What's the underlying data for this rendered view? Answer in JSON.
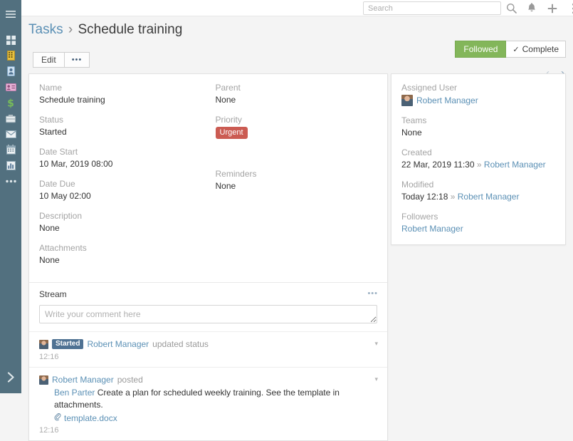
{
  "colors": {
    "sidebar_bg": "#52707f",
    "accent_link": "#5b90b5",
    "followed_green": "#83b65a",
    "urgent_red": "#cb5b52",
    "status_badge_blue": "#4f7293",
    "page_bg": "#f4f4f4"
  },
  "sidebar": {
    "items": [
      {
        "icon": "hamburger-menu-icon",
        "label": "Menu"
      },
      {
        "icon": "dashboard-grid-icon",
        "label": "Dashboard"
      },
      {
        "icon": "building-icon",
        "label": "Accounts"
      },
      {
        "icon": "id-card-icon",
        "label": "Contacts"
      },
      {
        "icon": "lead-card-icon",
        "label": "Leads"
      },
      {
        "icon": "dollar-icon",
        "label": "Opportunities"
      },
      {
        "icon": "briefcase-icon",
        "label": "Cases"
      },
      {
        "icon": "envelope-icon",
        "label": "Email"
      },
      {
        "icon": "calendar-icon",
        "label": "Calendar"
      },
      {
        "icon": "bar-chart-icon",
        "label": "Reports"
      },
      {
        "icon": "ellipsis-icon",
        "label": "More"
      }
    ],
    "expand": {
      "icon": "chevron-right-icon",
      "label": "Expand menu"
    }
  },
  "topbar": {
    "search": {
      "placeholder": "Search",
      "value": ""
    },
    "actions": [
      {
        "icon": "search-icon",
        "label": "Search"
      },
      {
        "icon": "bell-icon",
        "label": "Notifications"
      },
      {
        "icon": "plus-icon",
        "label": "Create"
      },
      {
        "icon": "vertical-dots-icon",
        "label": "Menu"
      }
    ]
  },
  "header": {
    "breadcrumb_parent": "Tasks",
    "breadcrumb_separator": "›",
    "breadcrumb_current": "Schedule training",
    "edit_label": "Edit",
    "more_label": "•••",
    "followed_label": "Followed",
    "complete_label": "Complete",
    "complete_check": "✓",
    "prev_label": "‹",
    "next_label": "›"
  },
  "detail": {
    "left_fields": [
      {
        "label": "Name",
        "value": "Schedule training"
      },
      {
        "label": "Status",
        "value": "Started"
      },
      {
        "label": "Date Start",
        "value": "10 Mar, 2019 08:00"
      },
      {
        "label": "Date Due",
        "value": "10 May 02:00"
      },
      {
        "label": "Description",
        "value": "None"
      },
      {
        "label": "Attachments",
        "value": "None"
      }
    ],
    "right_fields": [
      {
        "label": "Parent",
        "value": "None"
      },
      {
        "label": "Priority",
        "value": "Urgent"
      },
      {
        "label": "Reminders",
        "value": "None"
      }
    ]
  },
  "side_panel": {
    "assigned_user_label": "Assigned User",
    "assigned_user_value": "Robert Manager",
    "teams_label": "Teams",
    "teams_value": "None",
    "created_label": "Created",
    "created_value": "22 Mar, 2019 11:30",
    "created_sep": "»",
    "created_by": "Robert Manager",
    "modified_label": "Modified",
    "modified_value": "Today 12:18",
    "modified_sep": "»",
    "modified_by": "Robert Manager",
    "followers_label": "Followers",
    "followers_value": "Robert Manager"
  },
  "stream": {
    "title": "Stream",
    "menu_label": "•••",
    "comment_placeholder": "Write your comment here",
    "comment_value": "",
    "posts": [
      {
        "status_badge": "Started",
        "user": "Robert Manager",
        "action": "updated status",
        "body": "",
        "mention": "",
        "attachment": "",
        "time": "12:16",
        "caret": "▾"
      },
      {
        "status_badge": "",
        "user": "Robert Manager",
        "action": "posted",
        "mention": "Ben Parter",
        "body": "Create a plan for scheduled weekly training. See the template in attachments.",
        "attachment": "template.docx",
        "time": "12:16",
        "caret": "▾"
      }
    ]
  }
}
